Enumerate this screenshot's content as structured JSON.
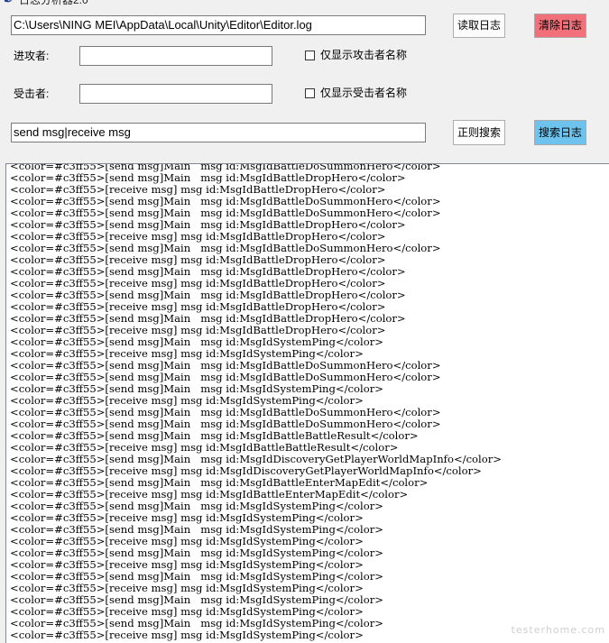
{
  "window": {
    "title": "日志分析器2.0",
    "icon": "feather-icon"
  },
  "path_field": {
    "value": "C:\\Users\\NING MEI\\AppData\\Local\\Unity\\Editor\\Editor.log"
  },
  "buttons": {
    "read_log": "读取日志",
    "clear_log": "清除日志",
    "regex_search": "正则搜索",
    "search_log": "搜索日志"
  },
  "attacker": {
    "label": "进攻者:",
    "value": "",
    "checkbox_label": "仅显示攻击者名称",
    "checked": false
  },
  "victim": {
    "label": "受击者:",
    "value": "",
    "checkbox_label": "仅显示受击者名称",
    "checked": false
  },
  "search_field": {
    "value": "send msg|receive msg"
  },
  "log_lines": [
    "<color=#c3ff55>[send msg]Main   msg id:MsgIdBattleDoSummonHero</color>",
    "<color=#c3ff55>[send msg]Main   msg id:MsgIdBattleDropHero</color>",
    "<color=#c3ff55>[receive msg] msg id:MsgIdBattleDropHero</color>",
    "<color=#c3ff55>[send msg]Main   msg id:MsgIdBattleDoSummonHero</color>",
    "<color=#c3ff55>[send msg]Main   msg id:MsgIdBattleDoSummonHero</color>",
    "<color=#c3ff55>[send msg]Main   msg id:MsgIdBattleDropHero</color>",
    "<color=#c3ff55>[receive msg] msg id:MsgIdBattleDropHero</color>",
    "<color=#c3ff55>[send msg]Main   msg id:MsgIdBattleDoSummonHero</color>",
    "<color=#c3ff55>[receive msg] msg id:MsgIdBattleDropHero</color>",
    "<color=#c3ff55>[send msg]Main   msg id:MsgIdBattleDropHero</color>",
    "<color=#c3ff55>[receive msg] msg id:MsgIdBattleDropHero</color>",
    "<color=#c3ff55>[send msg]Main   msg id:MsgIdBattleDropHero</color>",
    "<color=#c3ff55>[receive msg] msg id:MsgIdBattleDropHero</color>",
    "<color=#c3ff55>[send msg]Main   msg id:MsgIdBattleDropHero</color>",
    "<color=#c3ff55>[receive msg] msg id:MsgIdBattleDropHero</color>",
    "<color=#c3ff55>[send msg]Main   msg id:MsgIdSystemPing</color>",
    "<color=#c3ff55>[receive msg] msg id:MsgIdSystemPing</color>",
    "<color=#c3ff55>[send msg]Main   msg id:MsgIdBattleDoSummonHero</color>",
    "<color=#c3ff55>[send msg]Main   msg id:MsgIdBattleDoSummonHero</color>",
    "<color=#c3ff55>[send msg]Main   msg id:MsgIdSystemPing</color>",
    "<color=#c3ff55>[receive msg] msg id:MsgIdSystemPing</color>",
    "<color=#c3ff55>[send msg]Main   msg id:MsgIdBattleDoSummonHero</color>",
    "<color=#c3ff55>[send msg]Main   msg id:MsgIdBattleDoSummonHero</color>",
    "<color=#c3ff55>[send msg]Main   msg id:MsgIdBattleBattleResult</color>",
    "<color=#c3ff55>[receive msg] msg id:MsgIdBattleBattleResult</color>",
    "<color=#c3ff55>[send msg]Main   msg id:MsgIdDiscoveryGetPlayerWorldMapInfo</color>",
    "<color=#c3ff55>[receive msg] msg id:MsgIdDiscoveryGetPlayerWorldMapInfo</color>",
    "<color=#c3ff55>[send msg]Main   msg id:MsgIdBattleEnterMapEdit</color>",
    "<color=#c3ff55>[receive msg] msg id:MsgIdBattleEnterMapEdit</color>",
    "<color=#c3ff55>[send msg]Main   msg id:MsgIdSystemPing</color>",
    "<color=#c3ff55>[receive msg] msg id:MsgIdSystemPing</color>",
    "<color=#c3ff55>[send msg]Main   msg id:MsgIdSystemPing</color>",
    "<color=#c3ff55>[receive msg] msg id:MsgIdSystemPing</color>",
    "<color=#c3ff55>[send msg]Main   msg id:MsgIdSystemPing</color>",
    "<color=#c3ff55>[receive msg] msg id:MsgIdSystemPing</color>",
    "<color=#c3ff55>[send msg]Main   msg id:MsgIdSystemPing</color>",
    "<color=#c3ff55>[receive msg] msg id:MsgIdSystemPing</color>",
    "<color=#c3ff55>[send msg]Main   msg id:MsgIdSystemPing</color>",
    "<color=#c3ff55>[receive msg] msg id:MsgIdSystemPing</color>",
    "<color=#c3ff55>[send msg]Main   msg id:MsgIdSystemPing</color>",
    "<color=#c3ff55>[receive msg] msg id:MsgIdSystemPing</color>"
  ],
  "watermark": "testerhome.com",
  "colors": {
    "clear_button": "#f2707a",
    "search_button": "#6ec3ee",
    "window_bg": "#f0f0f0"
  }
}
